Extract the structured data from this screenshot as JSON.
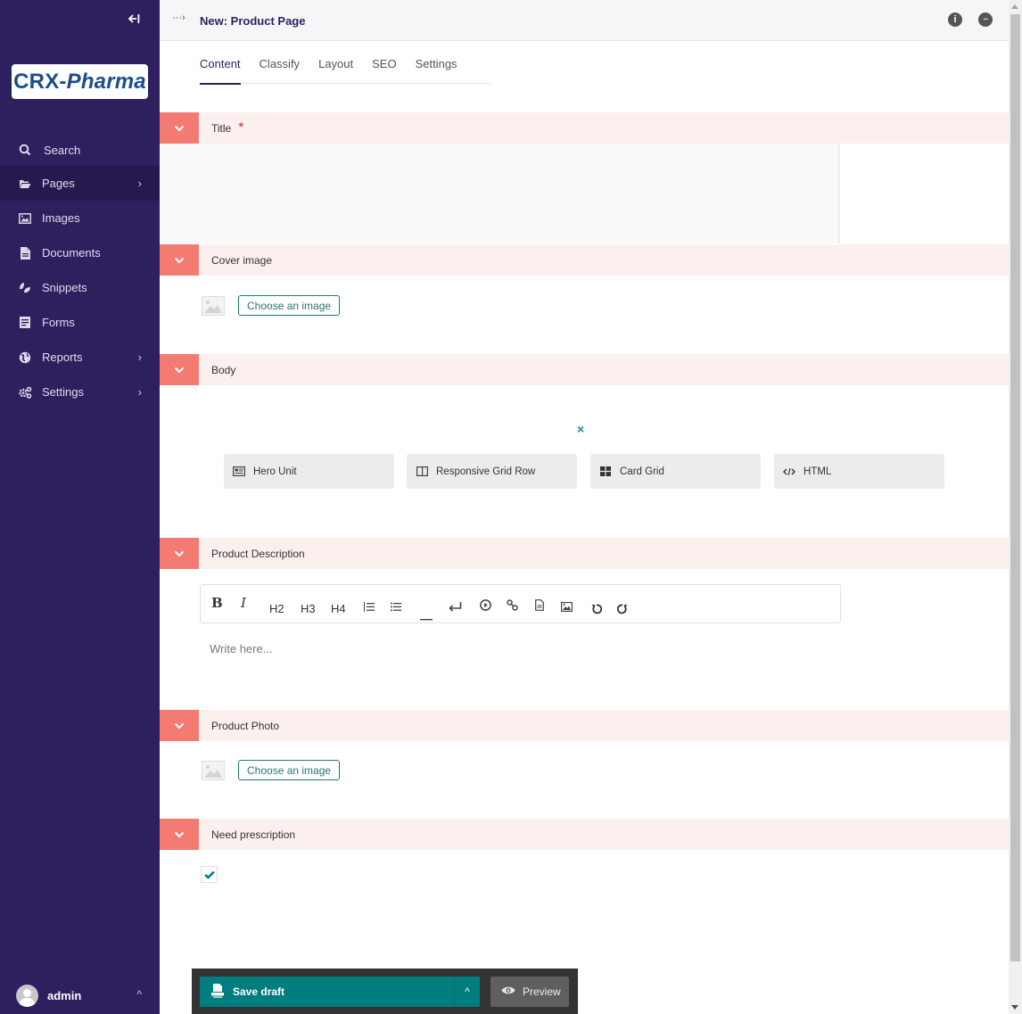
{
  "sidebar": {
    "collapse_icon": "collapse-left-icon",
    "logo": {
      "part1": "CRX-",
      "part2": "Pharma"
    },
    "items": [
      {
        "label": "Search",
        "icon": "search-icon",
        "has_submenu": false,
        "active": false
      },
      {
        "label": "Pages",
        "icon": "folder-open-icon",
        "has_submenu": true,
        "active": true
      },
      {
        "label": "Images",
        "icon": "image-icon",
        "has_submenu": false,
        "active": false
      },
      {
        "label": "Documents",
        "icon": "document-icon",
        "has_submenu": false,
        "active": false
      },
      {
        "label": "Snippets",
        "icon": "snippets-icon",
        "has_submenu": false,
        "active": false
      },
      {
        "label": "Forms",
        "icon": "form-icon",
        "has_submenu": false,
        "active": false
      },
      {
        "label": "Reports",
        "icon": "globe-icon",
        "has_submenu": true,
        "active": false
      },
      {
        "label": "Settings",
        "icon": "cogs-icon",
        "has_submenu": true,
        "active": false
      }
    ],
    "account": {
      "username": "admin",
      "chevron": "^"
    }
  },
  "header": {
    "breadcrumb_icon": "···›",
    "title": "New: Product Page",
    "info_icon": "i",
    "comments_icon": "···"
  },
  "tabs": [
    {
      "label": "Content",
      "active": true
    },
    {
      "label": "Classify",
      "active": false
    },
    {
      "label": "Layout",
      "active": false
    },
    {
      "label": "SEO",
      "active": false
    },
    {
      "label": "Settings",
      "active": false
    }
  ],
  "sections": {
    "title": {
      "label": "Title",
      "required_mark": "*",
      "value": ""
    },
    "cover_image": {
      "label": "Cover image",
      "button": "Choose an image"
    },
    "body": {
      "label": "Body",
      "close_icon": "×",
      "blocks": [
        {
          "label": "Hero Unit",
          "icon": "hero-unit-icon"
        },
        {
          "label": "Responsive Grid Row",
          "icon": "columns-icon"
        },
        {
          "label": "Card Grid",
          "icon": "grid-icon"
        },
        {
          "label": "HTML",
          "icon": "code-icon"
        }
      ]
    },
    "product_description": {
      "label": "Product Description",
      "toolbar": {
        "bold": "B",
        "italic": "I",
        "h2": "H2",
        "h3": "H3",
        "h4": "H4",
        "ordered_list": "≡",
        "bulleted_list": "☰",
        "horizontal_rule": "—",
        "line_break": "↵",
        "embed": "▶",
        "link": "🔗",
        "document": "📄",
        "image": "🖼",
        "undo": "↺",
        "redo": "↻"
      },
      "placeholder": "Write here..."
    },
    "product_photo": {
      "label": "Product Photo",
      "button": "Choose an image"
    },
    "need_prescription": {
      "label": "Need prescription",
      "checked": true
    }
  },
  "actions": {
    "save_label": "Save draft",
    "more_label": "^",
    "preview_label": "Preview"
  },
  "colors": {
    "sidebar": "#2e1f5e",
    "accent": "#007d7e",
    "section_toggle": "#f37b72",
    "section_bg": "#fcf0ef"
  }
}
